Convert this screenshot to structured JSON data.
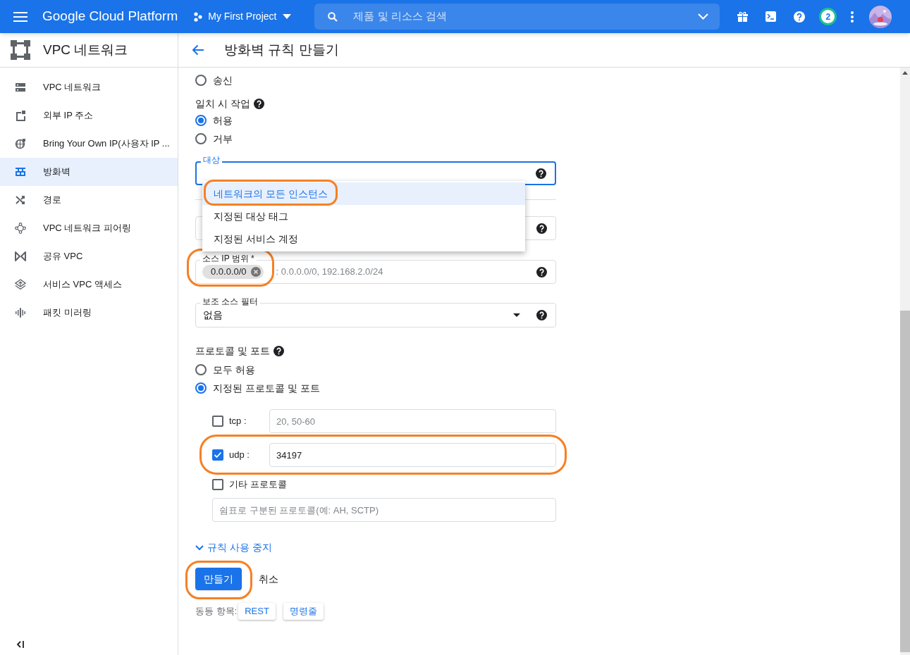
{
  "header": {
    "product": "Google Cloud Platform",
    "project": "My First Project",
    "search": {
      "placeholder": "제품 및 리소스 검색"
    },
    "notification_count": "2"
  },
  "sidebar": {
    "title": "VPC 네트워크",
    "items": [
      {
        "label": "VPC 네트워크",
        "selected": false
      },
      {
        "label": "외부 IP 주소",
        "selected": false
      },
      {
        "label": "Bring Your Own IP(사용자 IP ...",
        "selected": false
      },
      {
        "label": "방화벽",
        "selected": true
      },
      {
        "label": "경로",
        "selected": false
      },
      {
        "label": "VPC 네트워크 피어링",
        "selected": false
      },
      {
        "label": "공유 VPC",
        "selected": false
      },
      {
        "label": "서비스 VPC 액세스",
        "selected": false
      },
      {
        "label": "패킷 미러링",
        "selected": false
      }
    ]
  },
  "page": {
    "title": "방화벽 규칙 만들기"
  },
  "form": {
    "direction_options": [
      {
        "label": "송신",
        "selected": false
      }
    ],
    "action": {
      "label": "일치 시 작업",
      "options": [
        {
          "label": "허용",
          "selected": true
        },
        {
          "label": "거부",
          "selected": false
        }
      ]
    },
    "target": {
      "label": "대상",
      "menu": [
        {
          "label": "네트워크의 모든 인스턴스",
          "selected": true
        },
        {
          "label": "지정된 대상 태그",
          "selected": false
        },
        {
          "label": "지정된 서비스 계정",
          "selected": false
        }
      ]
    },
    "source_ip": {
      "label": "소스 IP 범위 *",
      "chips": [
        "0.0.0.0/0"
      ],
      "placeholder": ": 0.0.0.0/0, 192.168.2.0/24"
    },
    "secondary_filter": {
      "label": "보조 소스 필터",
      "value": "없음"
    },
    "protocols": {
      "label": "프로토콜 및 포트",
      "options": [
        {
          "label": "모두 허용",
          "selected": false
        },
        {
          "label": "지정된 프로토콜 및 포트",
          "selected": true
        }
      ],
      "ports": [
        {
          "label": "tcp :",
          "checked": false,
          "placeholder": "20, 50-60"
        },
        {
          "label": "udp :",
          "checked": true,
          "value": "34197"
        }
      ],
      "other": {
        "label": "기타 프로토콜",
        "checked": false,
        "placeholder": "쉼표로 구분된 프로토콜(예: AH, SCTP)"
      }
    },
    "disable_rule_link": "규칙 사용 중지",
    "create_button": "만들기",
    "cancel_button": "취소",
    "equivalent": {
      "label": "동등 항목:",
      "links": [
        "REST",
        "명령줄"
      ]
    }
  }
}
